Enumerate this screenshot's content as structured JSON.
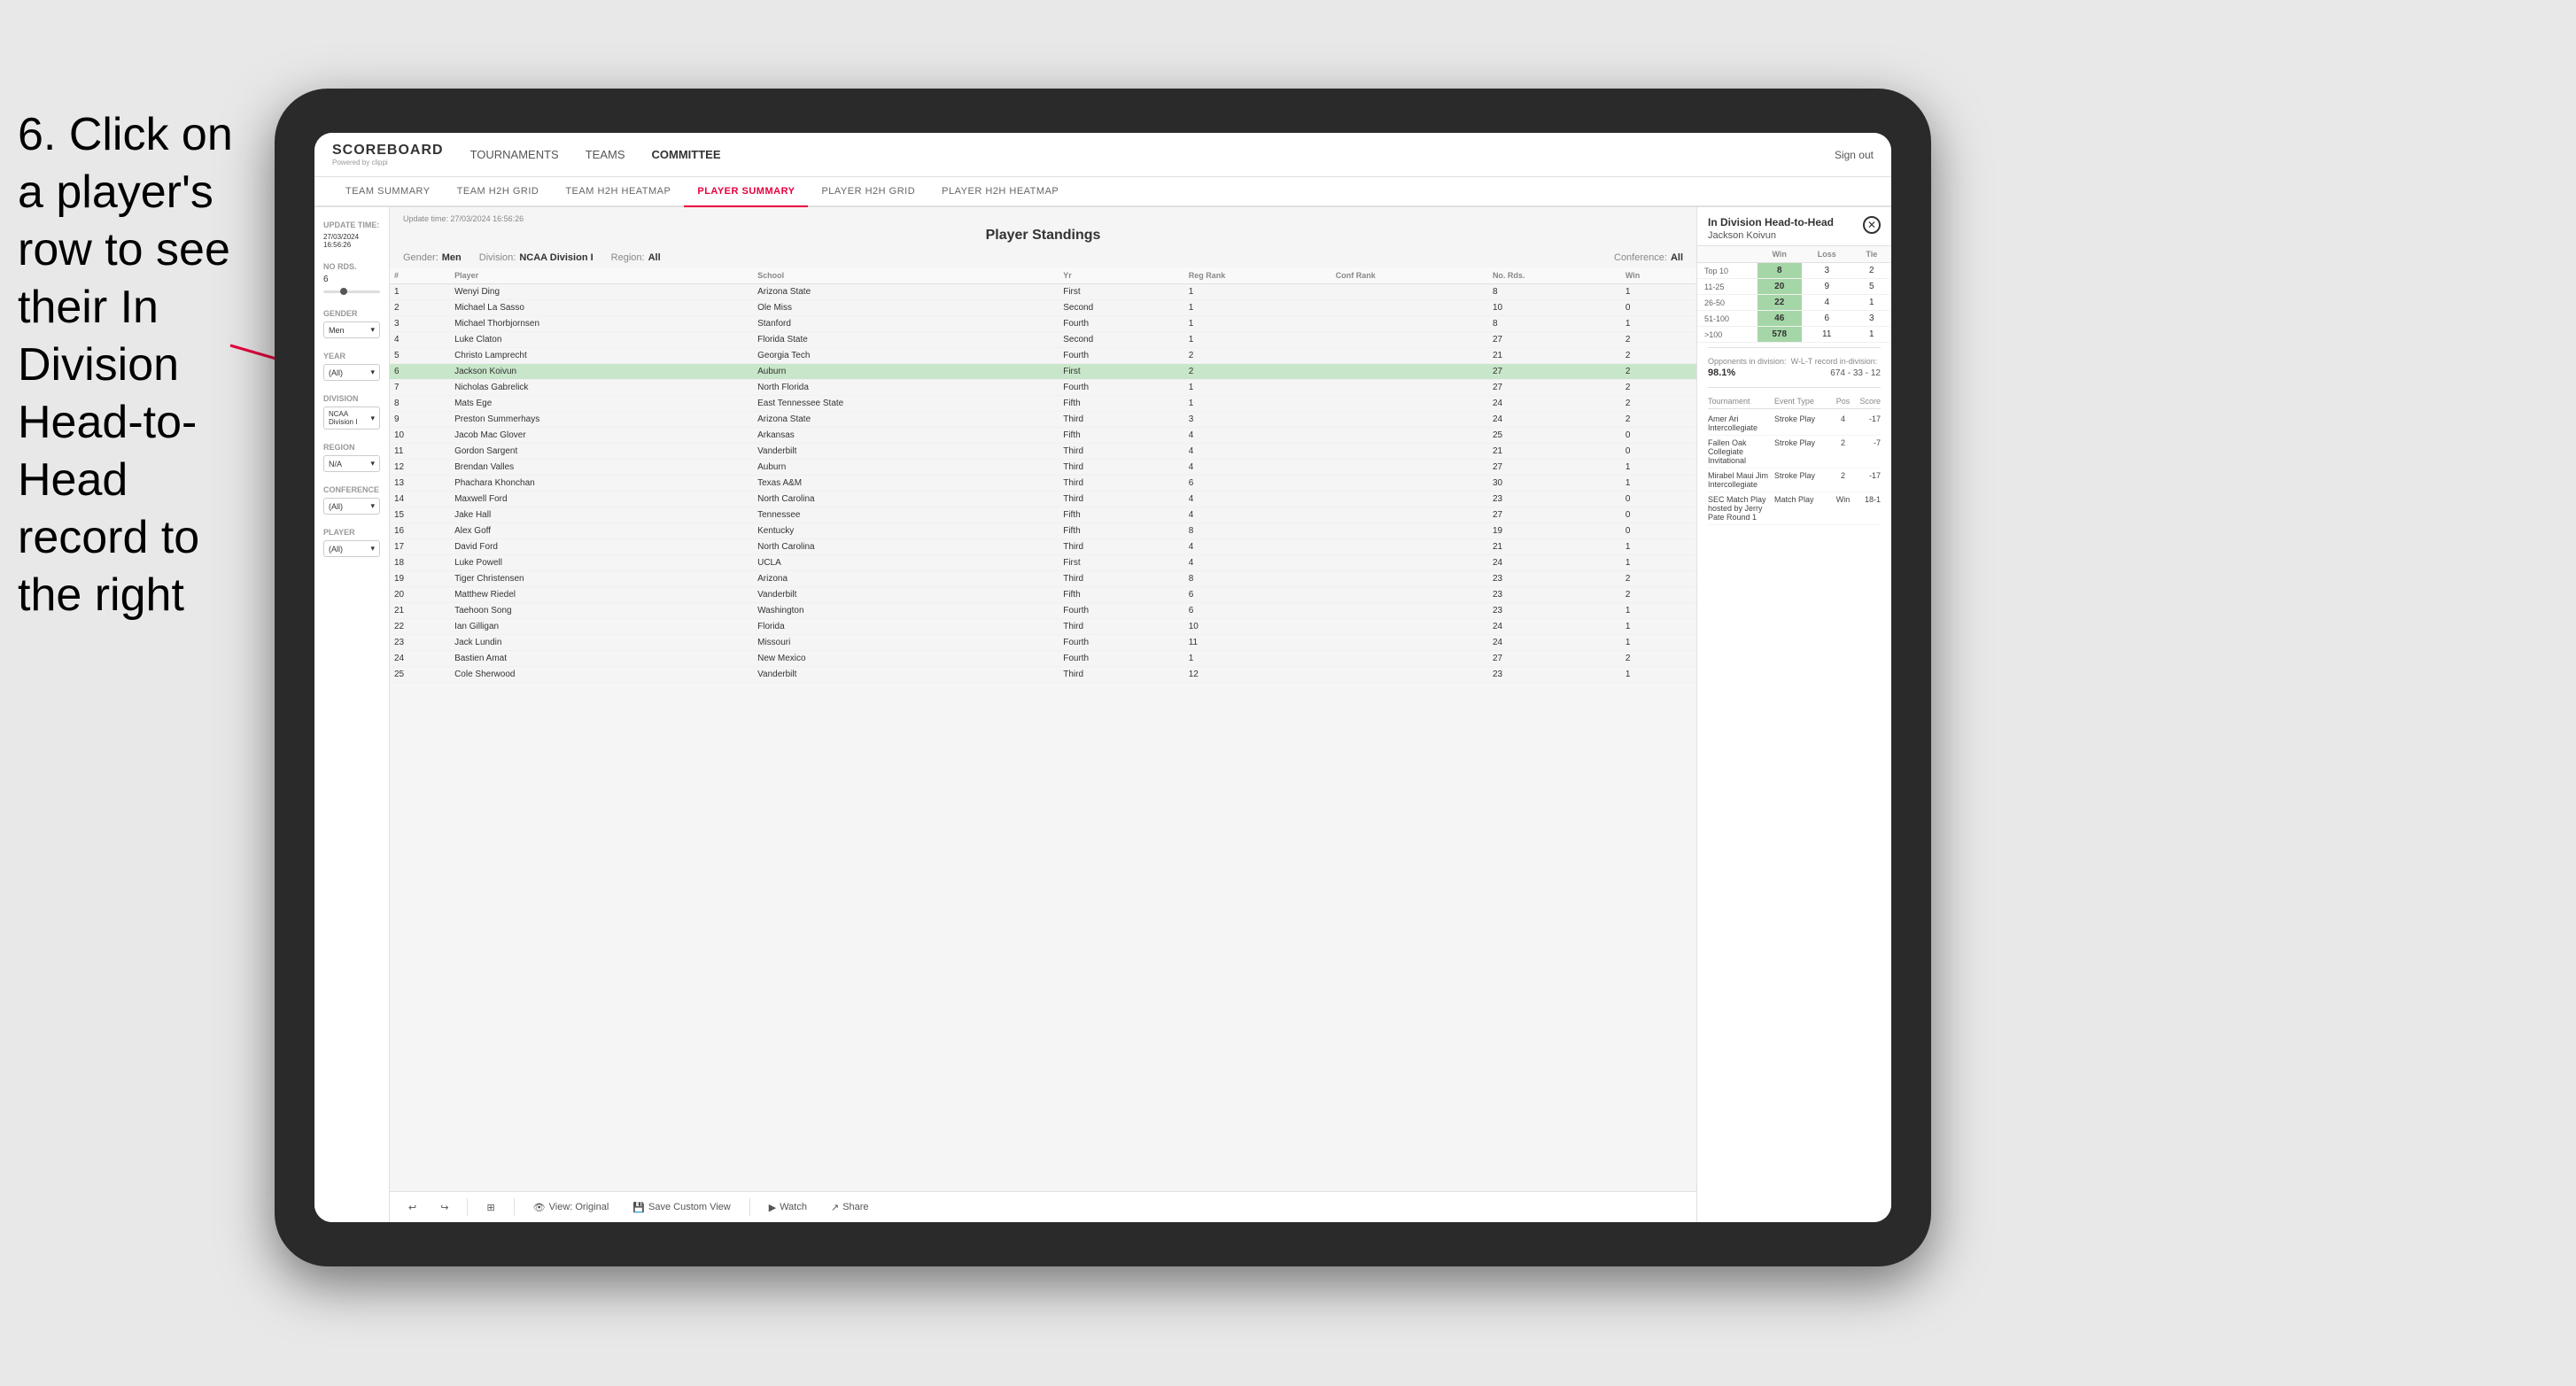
{
  "instruction": {
    "text": "6. Click on a player's row to see their In Division Head-to-Head record to the right"
  },
  "nav": {
    "logo": "SCOREBOARD",
    "logo_sub": "Powered by clippi",
    "items": [
      "TOURNAMENTS",
      "TEAMS",
      "COMMITTEE"
    ],
    "sign_out": "Sign out"
  },
  "sub_nav": {
    "items": [
      "TEAM SUMMARY",
      "TEAM H2H GRID",
      "TEAM H2H HEATMAP",
      "PLAYER SUMMARY",
      "PLAYER H2H GRID",
      "PLAYER H2H HEATMAP"
    ],
    "active": "PLAYER SUMMARY"
  },
  "sidebar": {
    "update_time_label": "Update time:",
    "update_time": "27/03/2024 16:56:26",
    "no_rds_label": "No Rds.",
    "no_rds_value": "6",
    "gender_label": "Gender",
    "gender_value": "Men",
    "year_label": "Year",
    "year_value": "(All)",
    "division_label": "Division",
    "division_value": "NCAA Division I",
    "region_label": "Region",
    "region_value": "N/A",
    "conference_label": "Conference",
    "conference_value": "(All)",
    "player_label": "Player",
    "player_value": "(All)"
  },
  "standings": {
    "title": "Player Standings",
    "gender": "Men",
    "division": "NCAA Division I",
    "region": "All",
    "conference": "All",
    "columns": [
      "#",
      "Player",
      "School",
      "Yr",
      "Reg Rank",
      "Conf Rank",
      "No. Rds.",
      "Win"
    ],
    "rows": [
      {
        "rank": 1,
        "player": "Wenyi Ding",
        "school": "Arizona State",
        "yr": "First",
        "reg_rank": 1,
        "conf_rank": "",
        "no_rds": 8,
        "win": 1
      },
      {
        "rank": 2,
        "player": "Michael La Sasso",
        "school": "Ole Miss",
        "yr": "Second",
        "reg_rank": 1,
        "conf_rank": "",
        "no_rds": 10,
        "win": 0
      },
      {
        "rank": 3,
        "player": "Michael Thorbjornsen",
        "school": "Stanford",
        "yr": "Fourth",
        "reg_rank": 1,
        "conf_rank": "",
        "no_rds": 8,
        "win": 1
      },
      {
        "rank": 4,
        "player": "Luke Claton",
        "school": "Florida State",
        "yr": "Second",
        "reg_rank": 1,
        "conf_rank": "",
        "no_rds": 27,
        "win": 2
      },
      {
        "rank": 5,
        "player": "Christo Lamprecht",
        "school": "Georgia Tech",
        "yr": "Fourth",
        "reg_rank": 2,
        "conf_rank": "",
        "no_rds": 21,
        "win": 2
      },
      {
        "rank": 6,
        "player": "Jackson Koivun",
        "school": "Auburn",
        "yr": "First",
        "reg_rank": 2,
        "conf_rank": "",
        "no_rds": 27,
        "win": 2,
        "selected": true
      },
      {
        "rank": 7,
        "player": "Nicholas Gabrelick",
        "school": "North Florida",
        "yr": "Fourth",
        "reg_rank": 1,
        "conf_rank": "",
        "no_rds": 27,
        "win": 2
      },
      {
        "rank": 8,
        "player": "Mats Ege",
        "school": "East Tennessee State",
        "yr": "Fifth",
        "reg_rank": 1,
        "conf_rank": "",
        "no_rds": 24,
        "win": 2
      },
      {
        "rank": 9,
        "player": "Preston Summerhays",
        "school": "Arizona State",
        "yr": "Third",
        "reg_rank": 3,
        "conf_rank": "",
        "no_rds": 24,
        "win": 2
      },
      {
        "rank": 10,
        "player": "Jacob Mac Glover",
        "school": "Arkansas",
        "yr": "Fifth",
        "reg_rank": 4,
        "conf_rank": "",
        "no_rds": 25,
        "win": 0
      },
      {
        "rank": 11,
        "player": "Gordon Sargent",
        "school": "Vanderbilt",
        "yr": "Third",
        "reg_rank": 4,
        "conf_rank": "",
        "no_rds": 21,
        "win": 0
      },
      {
        "rank": 12,
        "player": "Brendan Valles",
        "school": "Auburn",
        "yr": "Third",
        "reg_rank": 4,
        "conf_rank": "",
        "no_rds": 27,
        "win": 1
      },
      {
        "rank": 13,
        "player": "Phachara Khonchan",
        "school": "Texas A&M",
        "yr": "Third",
        "reg_rank": 6,
        "conf_rank": "",
        "no_rds": 30,
        "win": 1
      },
      {
        "rank": 14,
        "player": "Maxwell Ford",
        "school": "North Carolina",
        "yr": "Third",
        "reg_rank": 4,
        "conf_rank": "",
        "no_rds": 23,
        "win": 0
      },
      {
        "rank": 15,
        "player": "Jake Hall",
        "school": "Tennessee",
        "yr": "Fifth",
        "reg_rank": 4,
        "conf_rank": "",
        "no_rds": 27,
        "win": 0
      },
      {
        "rank": 16,
        "player": "Alex Goff",
        "school": "Kentucky",
        "yr": "Fifth",
        "reg_rank": 8,
        "conf_rank": "",
        "no_rds": 19,
        "win": 0
      },
      {
        "rank": 17,
        "player": "David Ford",
        "school": "North Carolina",
        "yr": "Third",
        "reg_rank": 4,
        "conf_rank": "",
        "no_rds": 21,
        "win": 1
      },
      {
        "rank": 18,
        "player": "Luke Powell",
        "school": "UCLA",
        "yr": "First",
        "reg_rank": 4,
        "conf_rank": "",
        "no_rds": 24,
        "win": 1
      },
      {
        "rank": 19,
        "player": "Tiger Christensen",
        "school": "Arizona",
        "yr": "Third",
        "reg_rank": 8,
        "conf_rank": "",
        "no_rds": 23,
        "win": 2
      },
      {
        "rank": 20,
        "player": "Matthew Riedel",
        "school": "Vanderbilt",
        "yr": "Fifth",
        "reg_rank": 6,
        "conf_rank": "",
        "no_rds": 23,
        "win": 2
      },
      {
        "rank": 21,
        "player": "Taehoon Song",
        "school": "Washington",
        "yr": "Fourth",
        "reg_rank": 6,
        "conf_rank": "",
        "no_rds": 23,
        "win": 1
      },
      {
        "rank": 22,
        "player": "Ian Gilligan",
        "school": "Florida",
        "yr": "Third",
        "reg_rank": 10,
        "conf_rank": "",
        "no_rds": 24,
        "win": 1
      },
      {
        "rank": 23,
        "player": "Jack Lundin",
        "school": "Missouri",
        "yr": "Fourth",
        "reg_rank": 11,
        "conf_rank": "",
        "no_rds": 24,
        "win": 1
      },
      {
        "rank": 24,
        "player": "Bastien Amat",
        "school": "New Mexico",
        "yr": "Fourth",
        "reg_rank": 1,
        "conf_rank": "",
        "no_rds": 27,
        "win": 2
      },
      {
        "rank": 25,
        "player": "Cole Sherwood",
        "school": "Vanderbilt",
        "yr": "Third",
        "reg_rank": 12,
        "conf_rank": "",
        "no_rds": 23,
        "win": 1
      }
    ]
  },
  "h2h_panel": {
    "title": "In Division Head-to-Head",
    "player_name": "Jackson Koivun",
    "headers": [
      "",
      "Win",
      "Loss",
      "Tie"
    ],
    "rows": [
      {
        "range": "Top 10",
        "win": 8,
        "loss": 3,
        "tie": 2
      },
      {
        "range": "11-25",
        "win": 20,
        "loss": 9,
        "tie": 5
      },
      {
        "range": "26-50",
        "win": 22,
        "loss": 4,
        "tie": 1
      },
      {
        "range": "51-100",
        "win": 46,
        "loss": 6,
        "tie": 3
      },
      {
        "range": ">100",
        "win": 578,
        "loss": 11,
        "tie": 1
      }
    ],
    "opponents_label": "Opponents in division:",
    "wl_label": "W-L-T record in-division:",
    "opponents_pct": "98.1%",
    "opponents_record": "674 - 33 - 12",
    "tournament_headers": [
      "Tournament",
      "Event Type",
      "Pos",
      "Score"
    ],
    "tournaments": [
      {
        "name": "Amer Ari Intercollegiate",
        "type": "Stroke Play",
        "pos": 4,
        "score": -17
      },
      {
        "name": "Fallen Oak Collegiate Invitational",
        "type": "Stroke Play",
        "pos": 2,
        "score": -7
      },
      {
        "name": "Mirabel Maui Jim Intercollegiate",
        "type": "Stroke Play",
        "pos": 2,
        "score": -17
      },
      {
        "name": "SEC Match Play hosted by Jerry Pate Round 1",
        "type": "Match Play",
        "pos": "Win",
        "score": "18-1"
      }
    ]
  },
  "toolbar": {
    "view_original": "View: Original",
    "save_custom": "Save Custom View",
    "watch": "Watch",
    "share": "Share"
  }
}
